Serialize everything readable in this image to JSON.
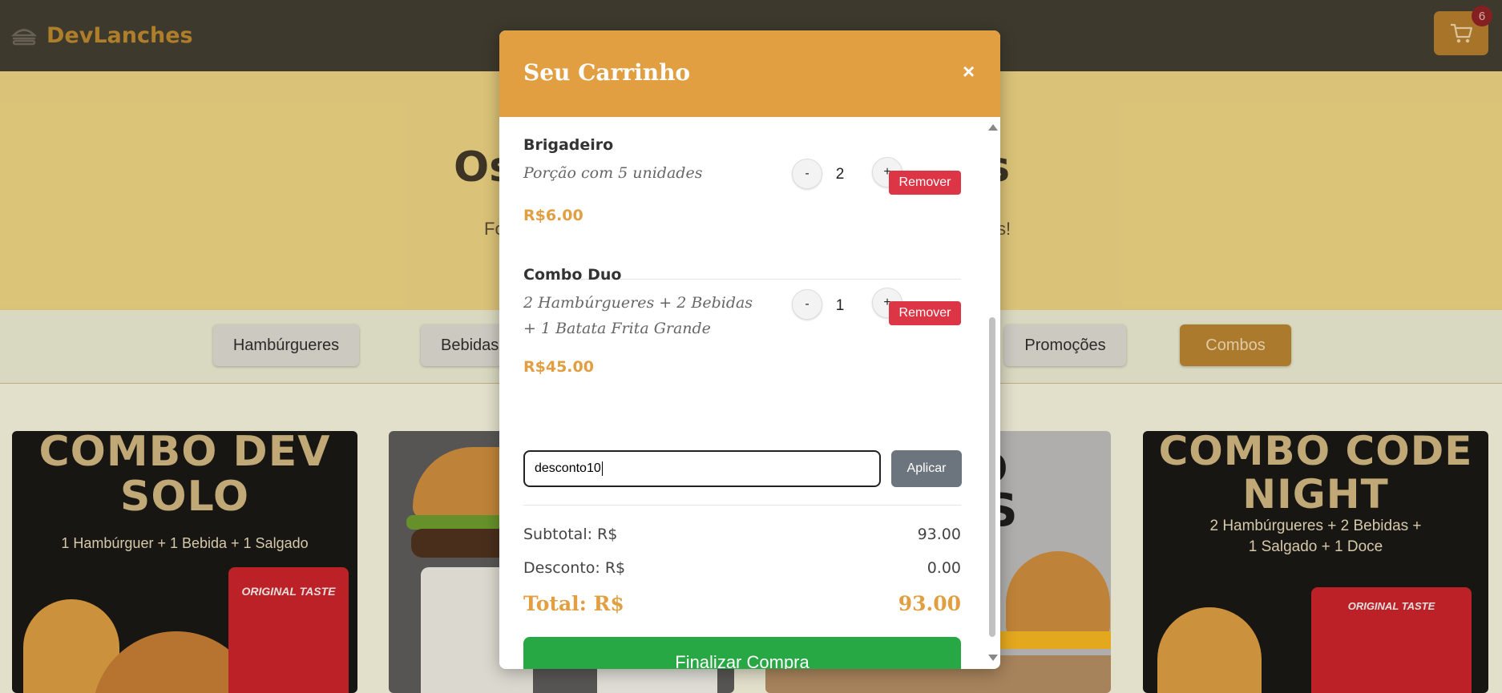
{
  "header": {
    "brand": "DevLanches",
    "cart_count": "6"
  },
  "hero": {
    "title_left": "Os",
    "title_right": "evs",
    "subtitle_left": "Fo",
    "subtitle_right": "s!"
  },
  "categories": [
    {
      "label": "Hambúrgueres"
    },
    {
      "label": "Bebidas"
    },
    {
      "label": "Promoções"
    },
    {
      "label": "Combos"
    }
  ],
  "cards": [
    {
      "title_line1": "COMBO DEV",
      "title_line2": "SOLO",
      "subtitle": "1 Hambúrguer + 1 Bebida + 1 Salgado",
      "can_text": "ORIGINAL TASTE"
    },
    {
      "title_line1": "MBO",
      "title_line2": "CHES"
    },
    {
      "title_line1": "COMBO CODE",
      "title_line2": "NIGHT",
      "subtitle_line1": "2 Hambúrgueres + 2 Bebidas +",
      "subtitle_line2": "1 Salgado + 1 Doce",
      "can_text": "ORIGINAL TASTE"
    }
  ],
  "modal": {
    "title": "Seu Carrinho",
    "close": "×",
    "items": [
      {
        "name": "Brigadeiro",
        "desc": "Porção com 5 unidades",
        "price": "R$6.00",
        "qty": "2",
        "minus": "-",
        "plus": "+",
        "remove": "Remover"
      },
      {
        "name": "Combo Duo",
        "desc": "2 Hambúrgueres + 2 Bebidas + 1 Batata Frita Grande",
        "price": "R$45.00",
        "qty": "1",
        "minus": "-",
        "plus": "+",
        "remove": "Remover"
      }
    ],
    "coupon": {
      "value": "desconto10",
      "apply": "Aplicar"
    },
    "summary": {
      "subtotal_label": "Subtotal: R$",
      "subtotal_value": "93.00",
      "discount_label": "Desconto: R$",
      "discount_value": "0.00",
      "total_label": "Total: R$",
      "total_value": "93.00"
    },
    "finish": "Finalizar Compra"
  },
  "colors": {
    "accent": "#e19f42",
    "header_bg": "#3d3a2f",
    "remove": "#dc3545",
    "finish": "#28a745",
    "apply": "#6c757d"
  }
}
